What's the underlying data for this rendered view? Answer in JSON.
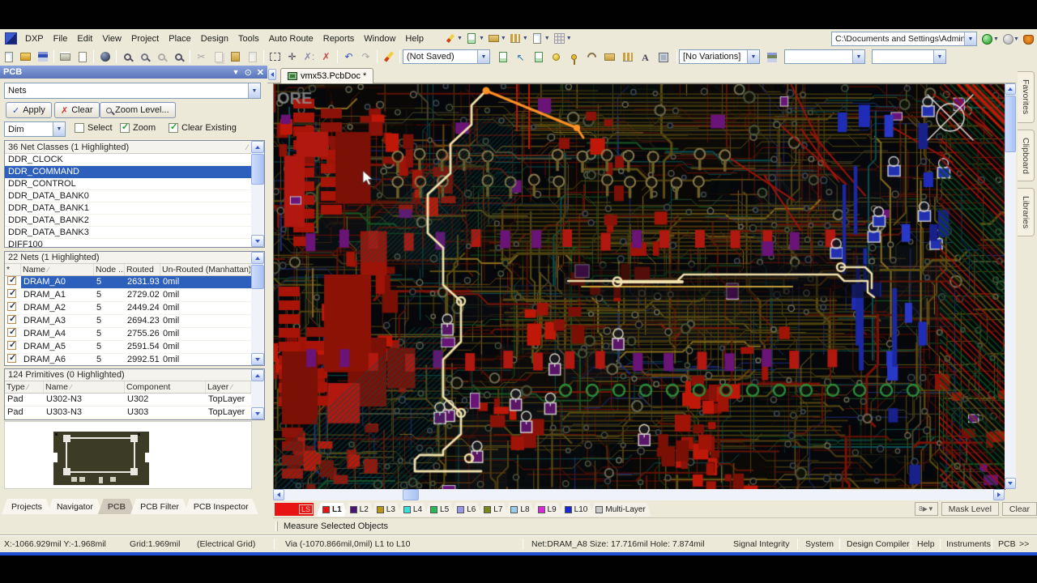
{
  "menu": {
    "items": [
      "DXP",
      "File",
      "Edit",
      "View",
      "Project",
      "Place",
      "Design",
      "Tools",
      "Auto Route",
      "Reports",
      "Window",
      "Help"
    ]
  },
  "toolbar": {
    "not_saved": "(Not Saved)",
    "no_variations": "[No Variations]",
    "path": "C:\\Documents and Settings\\Administra"
  },
  "pcb_panel": {
    "title": "PCB",
    "mode": "Nets",
    "apply_label": "Apply",
    "clear_label": "Clear",
    "zoom_level_label": "Zoom Level...",
    "dim_label": "Dim",
    "options": [
      {
        "label": "Select",
        "checked": false
      },
      {
        "label": "Zoom",
        "checked": true
      },
      {
        "label": "Clear Existing",
        "checked": true
      }
    ],
    "net_classes": {
      "header": "36 Net Classes (1 Highlighted)",
      "items": [
        "DDR_CLOCK",
        "DDR_COMMAND",
        "DDR_CONTROL",
        "DDR_DATA_BANK0",
        "DDR_DATA_BANK1",
        "DDR_DATA_BANK2",
        "DDR_DATA_BANK3",
        "DIFF100"
      ],
      "selected": "DDR_COMMAND"
    },
    "nets": {
      "header": "22 Nets (1 Highlighted)",
      "columns": [
        "Name",
        "Node ...",
        "Routed",
        "Un-Routed (Manhattan)"
      ],
      "all_checked": true,
      "selected": "DRAM_A0",
      "rows": [
        [
          "DRAM_A0",
          "5",
          "2631.93",
          "0mil"
        ],
        [
          "DRAM_A1",
          "5",
          "2729.02",
          "0mil"
        ],
        [
          "DRAM_A2",
          "5",
          "2449.24",
          "0mil"
        ],
        [
          "DRAM_A3",
          "5",
          "2694.23",
          "0mil"
        ],
        [
          "DRAM_A4",
          "5",
          "2755.26",
          "0mil"
        ],
        [
          "DRAM_A5",
          "5",
          "2591.54",
          "0mil"
        ],
        [
          "DRAM_A6",
          "5",
          "2992.51",
          "0mil"
        ]
      ]
    },
    "primitives": {
      "header": "124 Primitives (0 Highlighted)",
      "columns": [
        "Type",
        "Name",
        "Component",
        "Layer"
      ],
      "rows": [
        [
          "Pad",
          "U302-N3",
          "U302",
          "TopLayer"
        ],
        [
          "Pad",
          "U303-N3",
          "U303",
          "TopLayer"
        ]
      ]
    },
    "tabs": [
      "Projects",
      "Navigator",
      "PCB",
      "PCB Filter",
      "PCB Inspector"
    ],
    "active_tab": "PCB"
  },
  "document": {
    "tab": "vmx53.PcbDoc *",
    "watermark": "ORE"
  },
  "right_tabs": [
    "Favorites",
    "Clipboard",
    "Libraries"
  ],
  "layers": {
    "current": {
      "label": "LS",
      "color": "#e81414"
    },
    "active": "L1",
    "tabs": [
      {
        "label": "L1",
        "color": "#e81414"
      },
      {
        "label": "L2",
        "color": "#4a1478"
      },
      {
        "label": "L3",
        "color": "#b89418"
      },
      {
        "label": "L4",
        "color": "#38e0d8"
      },
      {
        "label": "L5",
        "color": "#28b858"
      },
      {
        "label": "L6",
        "color": "#9898e8"
      },
      {
        "label": "L7",
        "color": "#788818"
      },
      {
        "label": "L8",
        "color": "#98cce8"
      },
      {
        "label": "L9",
        "color": "#d828d8"
      },
      {
        "label": "L10",
        "color": "#1828d8"
      },
      {
        "label": "Multi-Layer",
        "color": "#c8c8c8"
      }
    ],
    "mask_level_label": "Mask Level",
    "clear_label": "Clear"
  },
  "measure_label": "Measure Selected Objects",
  "status": {
    "coords": "X:-1066.929mil Y:-1.968mil",
    "grid": "Grid:1.969mil",
    "grid_mode": "(Electrical Grid)",
    "via": "Via (-1070.866mil,0mil) L1 to L10",
    "net": "Net:DRAM_A8 Size: 17.716mil Hole: 7.874mil",
    "buttons": [
      "Signal Integrity",
      "System",
      "Design Compiler",
      "Help",
      "Instruments",
      "PCB",
      ">>"
    ]
  },
  "pcb_colors": {
    "background": "#05070a",
    "highlight": "#f2e2ae",
    "highlight_dark": "#c8a23a",
    "highlight_orange": "#ff9226",
    "red_pad": "#a01408",
    "purple_pad": "#6a1478",
    "olive_trace": "#5a4c12",
    "maroon_trace": "#641206",
    "teal_trace": "#094f4f",
    "green_trace": "#155422",
    "blue_fill": "#1f2cb8",
    "via_ring": "#6a6a52"
  }
}
